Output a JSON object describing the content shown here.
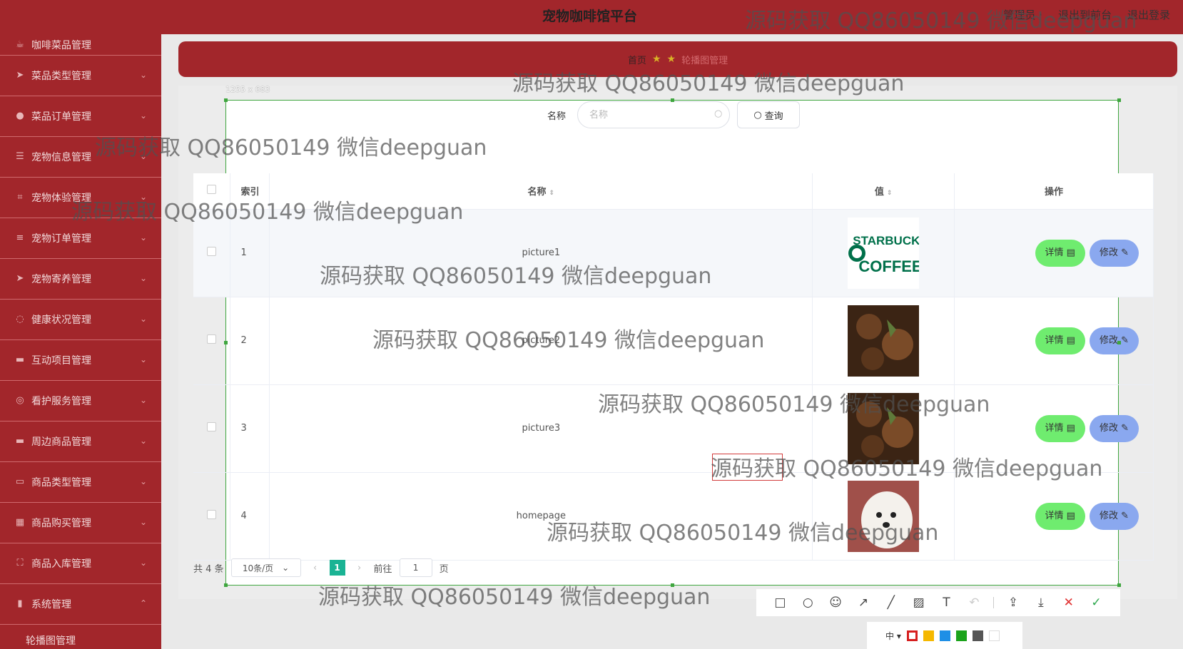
{
  "app": {
    "title": "宠物咖啡馆平台",
    "header_links": [
      "管理员 ·",
      "退出到前台",
      "退出登录"
    ]
  },
  "sidebar": {
    "items": [
      {
        "label": "咖啡菜品管理",
        "icon": "coffee-icon"
      },
      {
        "label": "菜品类型管理",
        "icon": "send-icon"
      },
      {
        "label": "菜品订单管理",
        "icon": "user-icon"
      },
      {
        "label": "宠物信息管理",
        "icon": "list-icon"
      },
      {
        "label": "宠物体验管理",
        "icon": "crop-icon"
      },
      {
        "label": "宠物订单管理",
        "icon": "menu-icon"
      },
      {
        "label": "宠物寄养管理",
        "icon": "send-icon"
      },
      {
        "label": "健康状况管理",
        "icon": "circle-icon"
      },
      {
        "label": "互动项目管理",
        "icon": "card-icon"
      },
      {
        "label": "看护服务管理",
        "icon": "compass-icon"
      },
      {
        "label": "周边商品管理",
        "icon": "card-icon"
      },
      {
        "label": "商品类型管理",
        "icon": "message-icon"
      },
      {
        "label": "商品购买管理",
        "icon": "grid-icon"
      },
      {
        "label": "商品入库管理",
        "icon": "frame-icon"
      },
      {
        "label": "系统管理",
        "icon": "chart-icon"
      }
    ],
    "sub_item": "轮播图管理"
  },
  "breadcrumb": {
    "home": "首页",
    "current": "轮播图管理"
  },
  "screenshot": {
    "size_label": "1255 x 683"
  },
  "search": {
    "label": "名称",
    "placeholder": "名称",
    "button": "查询"
  },
  "table": {
    "headers": {
      "index": "索引",
      "name": "名称",
      "value": "值",
      "actions": "操作"
    },
    "rows": [
      {
        "index": "1",
        "name": "picture1",
        "image": "starbucks-logo"
      },
      {
        "index": "2",
        "name": "picture2",
        "image": "coffee-beans"
      },
      {
        "index": "3",
        "name": "picture3",
        "image": "coffee-beans"
      },
      {
        "index": "4",
        "name": "homepage",
        "image": "white-dog"
      }
    ],
    "detail_label": "详情",
    "edit_label": "修改"
  },
  "pager": {
    "total": "共 4 条",
    "page_size": "10条/页",
    "current_page": "1",
    "goto_prefix": "前往",
    "goto_value": "1",
    "goto_suffix": "页"
  },
  "toolbar": {
    "font_size": "中",
    "colors": [
      "#d61f1f",
      "#f5b800",
      "#1f8fe6",
      "#1ba31b",
      "#555555",
      "#ffffff"
    ]
  },
  "watermark": "源码获取 QQ86050149 微信deepguan"
}
